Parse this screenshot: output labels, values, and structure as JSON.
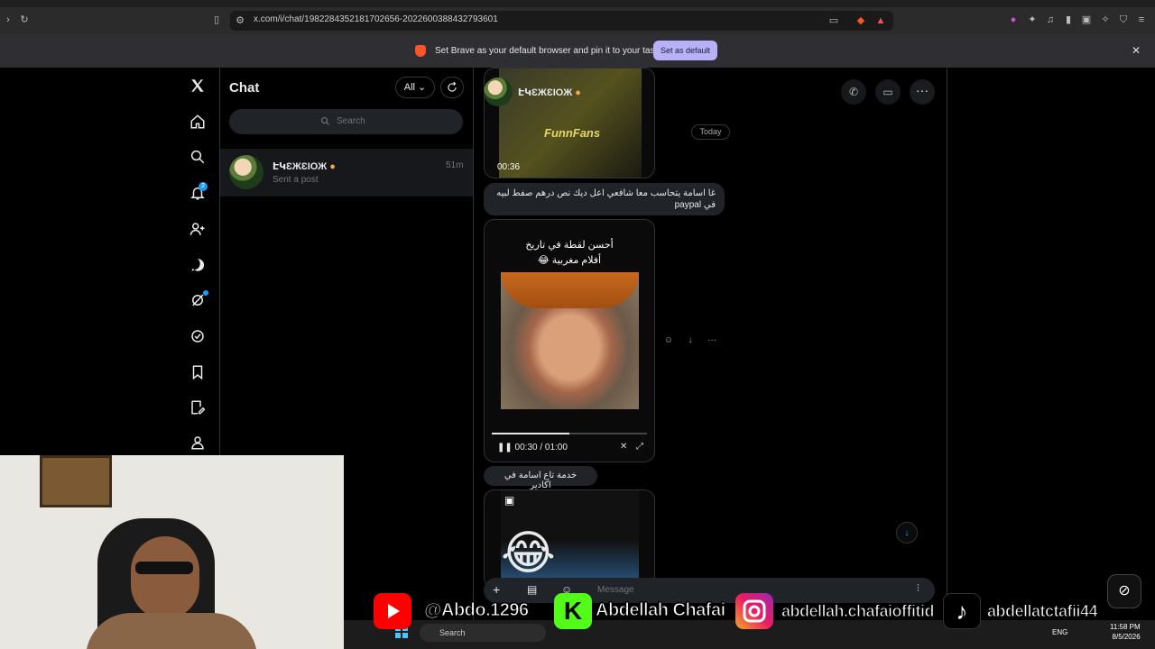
{
  "browser": {
    "url": "x.com/i/chat/1982284352181702656-2022600388432793601",
    "infobar_text": "Set Brave as your default browser and pin it to your taskbar",
    "set_default_label": "Set as default",
    "close_label": "✕"
  },
  "nav": {
    "notifications_badge": "2"
  },
  "chat_list": {
    "title": "Chat",
    "filter_label": "All",
    "search_placeholder": "Search",
    "conversations": [
      {
        "name": "ԷԿƐЖƐIОЖ",
        "time": "51m",
        "preview": "Sent a post"
      }
    ]
  },
  "conversation": {
    "header_name": "ԷԿƐЖƐIОЖ",
    "date_separator": "Today",
    "video1_logo": "FunnFans",
    "video1_duration": "00:36",
    "message1": "غا اسامة يتحاسب معا شافعي اعل ديك نص درهم صفط لبيه في paypal",
    "video2_caption_line1": "أحسن لقطة في تاريخ",
    "video2_caption_line2": "أفلام مغربية 😂",
    "video2_time": "00:30 / 01:00",
    "video2_progress": 0.5,
    "message2": "خدمة تاع اسامة في اكادير",
    "composer_placeholder": "Message"
  },
  "overlay": {
    "youtube_handle": "@Abdo.1296",
    "kick_name": "Abdellah Chafai",
    "instagram_handle": "abdellah.chafaioffitid",
    "tiktok_handle": "abdellatctafii44"
  },
  "taskbar": {
    "search_label": "Search",
    "language": "ENG",
    "time": "11:58 PM",
    "date": "8/5/2026"
  }
}
